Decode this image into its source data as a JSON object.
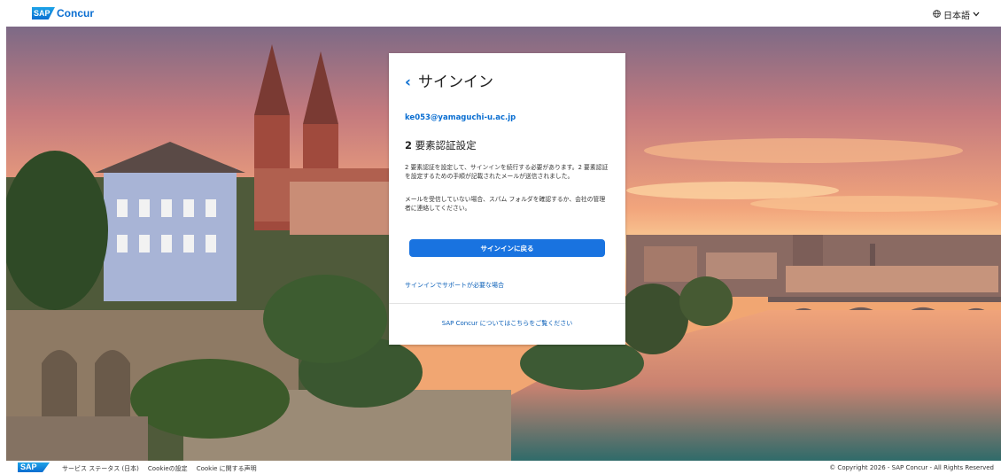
{
  "header": {
    "logo_mark": "SAP",
    "logo_text": "Concur",
    "language": "日本語",
    "language_icon": "globe-icon",
    "chevron_icon": "chevron-down-icon"
  },
  "card": {
    "back_title": "サインイン",
    "back_icon": "chevron-left-icon",
    "email": "ke053@yamaguchi-u.ac.jp",
    "heading_num": "2",
    "heading_text": " 要素認証設定",
    "paragraph1": "2 要素認証を設定して、サインインを続行する必要があります。2 要素認証を設定するための手順が記載されたメールが送信されました。",
    "paragraph2": "メールを受信していない場合、スパム フォルダを確認するか、会社の管理者に連絡してください。",
    "primary_button": "サインインに戻る",
    "help_link": "サインインでサポートが必要な場合",
    "learn_more_link": "SAP Concur についてはこちらをご覧ください"
  },
  "footer": {
    "logo_mark": "SAP",
    "links": [
      "サービス ステータス (日本)",
      "Cookieの設定",
      "Cookie に関する声明"
    ],
    "copyright": "© Copyright 2026 - SAP Concur - All Rights Reserved"
  },
  "colors": {
    "accent": "#0a6ed1",
    "button": "#1973e0"
  }
}
